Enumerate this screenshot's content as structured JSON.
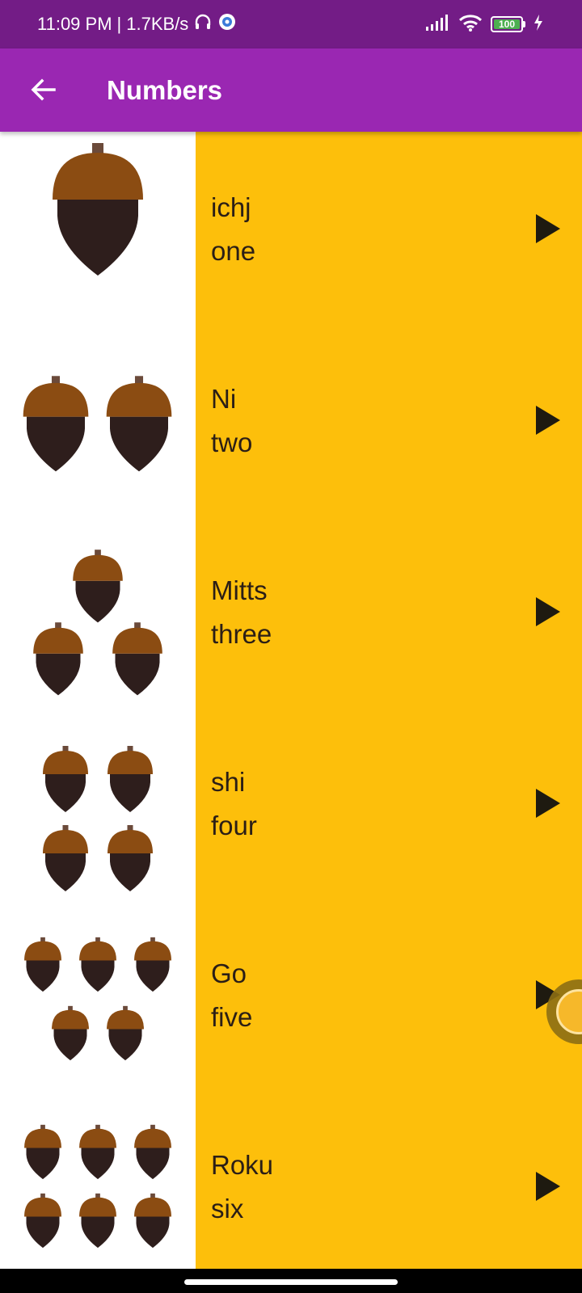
{
  "status_bar": {
    "time": "11:09 PM",
    "separator": "|",
    "net_speed": "1.7KB/s",
    "battery_level": "100",
    "icons": [
      "headset-icon",
      "settings-icon",
      "signal-icon",
      "wifi-icon",
      "battery-icon",
      "charging-icon"
    ]
  },
  "app_bar": {
    "title": "Numbers",
    "back_icon": "arrow-back-icon"
  },
  "colors": {
    "status_bar": "#731c86",
    "app_bar": "#9a27b2",
    "list_background": "#fdbf0b",
    "text": "#2b1e16",
    "acorn_cap": "#8b4c12",
    "acorn_body": "#2e1e1c"
  },
  "words": [
    {
      "foreign": "ichj",
      "english": "one",
      "count": 1
    },
    {
      "foreign": "Ni",
      "english": "two",
      "count": 2
    },
    {
      "foreign": "Mitts",
      "english": "three",
      "count": 3
    },
    {
      "foreign": "shi",
      "english": "four",
      "count": 4
    },
    {
      "foreign": "Go",
      "english": "five",
      "count": 5
    },
    {
      "foreign": "Roku",
      "english": "six",
      "count": 6
    }
  ]
}
